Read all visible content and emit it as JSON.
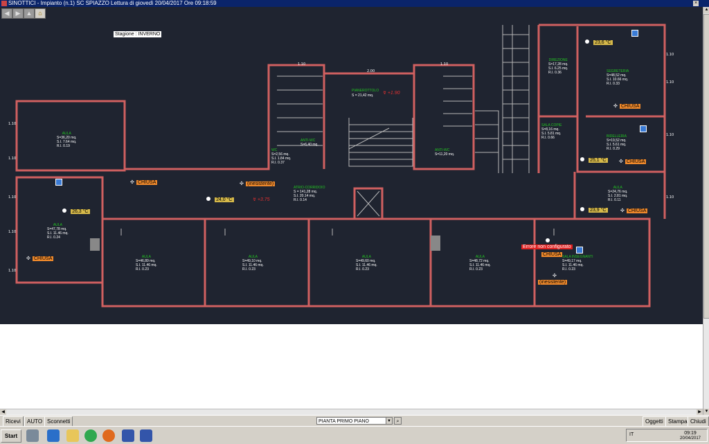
{
  "window": {
    "title": "SINOTTICI - Impianto (n.1) SC SPIAZZO     Lettura di giovedì 20/04/2017 Ore 09:18:59",
    "close_glyph": "×"
  },
  "nav": {
    "back_glyph": "◀",
    "forward_glyph": "▶",
    "up_glyph": "▲",
    "home_glyph": "⌂"
  },
  "season": "Stagione : INVERNO",
  "sensors": [
    {
      "temp": "23,6 °C",
      "status": "CHIUSA"
    },
    {
      "temp": "25,1 °C",
      "status": "CHIUSA"
    },
    {
      "temp": "23,9 °C",
      "status": "CHIUSA"
    },
    {
      "temp": "24,0 °C",
      "status": "(inesistente)"
    },
    {
      "temp": "26,3 °C",
      "status": "CHIUSA"
    }
  ],
  "zone_status": {
    "corridor_left": "CHIUSA",
    "zone_error": "Errore non configurato",
    "zone_error_status": "CHIUSA",
    "zone_error_extra": "(inesistente)"
  },
  "elevations": {
    "landing": "+1.90",
    "corridor": "+3.75"
  },
  "rooms": [
    {
      "name": "AULA",
      "area": "S=36,20 mq.",
      "si": "S.I. 7.64 mq.",
      "ri": "R.I. 0.19"
    },
    {
      "name": "AULA",
      "area": "S=47,78 mq.",
      "si": "S.I. 11.46 mq.",
      "ri": "R.I. 0.24"
    },
    {
      "name": "AULA",
      "area": "S=46,89 mq.",
      "si": "S.I. 11.46 mq.",
      "ri": "R.I. 0.23"
    },
    {
      "name": "AULA",
      "area": "S=49,10 mq.",
      "si": "S.I. 11.46 mq.",
      "ri": "R.I. 0.23"
    },
    {
      "name": "AULA",
      "area": "S=49,60 mq.",
      "si": "S.I. 11.46 mq.",
      "ri": "R.I. 0.23"
    },
    {
      "name": "AULA",
      "area": "S=48,72 mq.",
      "si": "S.I. 11.46 mq.",
      "ri": "R.I. 0.23"
    },
    {
      "name": "SALA INSEGNANTI",
      "area": "S=49,17 mq.",
      "si": "S.I. 11.46 mq.",
      "ri": "R.I. 0.23"
    },
    {
      "name": "ATRIO-CORRIDOIO",
      "area": "S = 141,28 mq.",
      "si": "S.I. 20.14 mq.",
      "ri": "R.I. 0.14"
    },
    {
      "name": "PIANEROTTOLO",
      "area": "S = 21,42 mq.",
      "si": "",
      "ri": ""
    },
    {
      "name": "DIREZIONE",
      "area": "S=17,28 mq.",
      "si": "S.I. 6.25 mq.",
      "ri": "R.I. 0.36"
    },
    {
      "name": "SEGRETERIA",
      "area": "S=48,52 mq.",
      "si": "S.I. 10.66 mq.",
      "ri": "R.I. 0.33"
    },
    {
      "name": "SALA COPIE",
      "area": "S=8,16 mq.",
      "si": "S.I. 5.81 mq.",
      "ri": "R.I. 0.66"
    },
    {
      "name": "BIDELLERIA",
      "area": "S=19,52 mq.",
      "si": "S.I. 5.61 mq.",
      "ri": "R.I. 0.29"
    },
    {
      "name": "AULA",
      "area": "S=24,76 mq.",
      "si": "S.I. 2.81 mq.",
      "ri": "R.I. 0.11"
    },
    {
      "name": "ANTI-WC",
      "area": "S=6,40 mq.",
      "si": "",
      "ri": ""
    },
    {
      "name": "ANTI-WC",
      "area": "S=11,20 mq.",
      "si": "",
      "ri": ""
    },
    {
      "name": "WC",
      "area": "S=2,56 mq.",
      "si": "S.I. 1.84 mq.",
      "ri": "R.I. 0.37"
    }
  ],
  "toolbar": {
    "ricevi": "Ricevi",
    "auto": "AUTO",
    "sconnetti": "Sconnetti",
    "view_value": "PIANTA PRIMO PIANO",
    "view_arrow": "▼",
    "zoom_glyph": "⌕",
    "oggetti": "Oggetti",
    "stampa": "Stampa",
    "chiudi": "Chiudi"
  },
  "taskbar": {
    "start": "Start",
    "lang": "IT",
    "time": "09:19",
    "date": "20/04/2017"
  },
  "scroll": {
    "up": "▲",
    "down": "▼",
    "left": "◀",
    "right": "▶"
  },
  "colors": {
    "plan_bg": "#1f2430",
    "wall": "#d06060",
    "temp_badge": "#d6b94a",
    "status_badge": "#f08a2c",
    "error": "#e02020",
    "room_label": "#22c422"
  }
}
